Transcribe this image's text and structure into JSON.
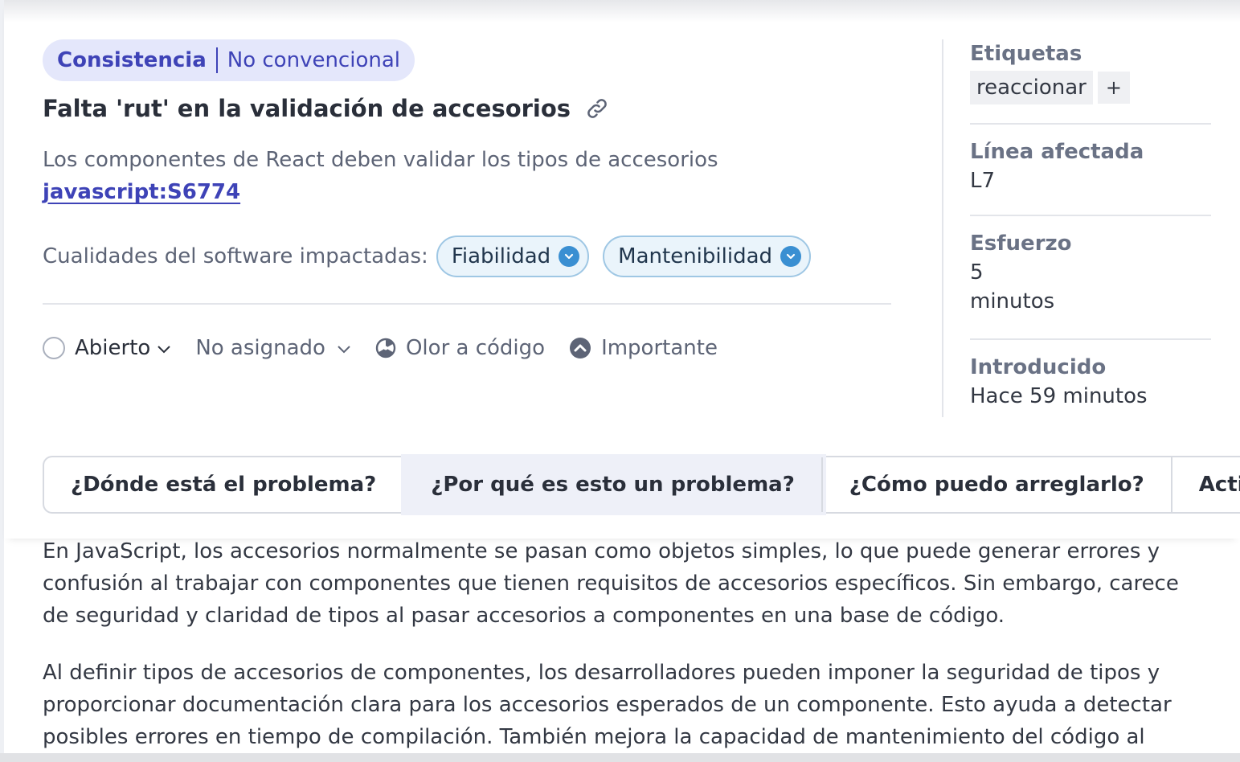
{
  "badge": {
    "category": "Consistencia",
    "attribute": "No convencional"
  },
  "issue": {
    "title": "Falta 'rut' en la validación de accesorios",
    "rule_description": "Los componentes de React deben validar los tipos de accesorios",
    "rule_key": "javascript:S6774"
  },
  "qualities": {
    "label": "Cualidades del software impactadas:",
    "items": [
      {
        "name": "Fiabilidad"
      },
      {
        "name": "Mantenibilidad"
      }
    ]
  },
  "status_row": {
    "status": "Abierto",
    "assignee": "No asignado",
    "type": "Olor a código",
    "severity": "Importante"
  },
  "sidebar": {
    "tags_label": "Etiquetas",
    "tag": "reaccionar",
    "add_tag": "+",
    "line_label": "Línea afectada",
    "line_value": "L7",
    "effort_label": "Esfuerzo",
    "effort_value": "5",
    "effort_unit": "minutos",
    "introduced_label": "Introducido",
    "introduced_value": "Hace 59 minutos"
  },
  "tabs": [
    {
      "label": "¿Dónde está el problema?",
      "selected": false
    },
    {
      "label": "¿Por qué es esto un problema?",
      "selected": true
    },
    {
      "label": "¿Cómo puedo arreglarlo?",
      "selected": false
    },
    {
      "label": "Actividad",
      "selected": false
    }
  ],
  "article": {
    "paragraphs": [
      "En JavaScript, los accesorios normalmente se pasan como objetos simples, lo que puede generar errores y confusión al trabajar con componentes que tienen requisitos de accesorios específicos. Sin embargo, carece de seguridad y claridad de tipos al pasar accesorios a componentes en una base de código.",
      "Al definir tipos de accesorios de componentes, los desarrolladores pueden imponer la seguridad de tipos y proporcionar documentación clara para los accesorios esperados de un componente. Esto ayuda a detectar posibles errores en tiempo de compilación. También mejora la capacidad de mantenimiento del código al"
    ]
  },
  "colors": {
    "accent": "#3e43b7",
    "badge_bg": "#e4e7fb",
    "quality_bg": "#eaf4fb",
    "quality_border": "#9fc7e4",
    "quality_icon": "#3a8fd2"
  },
  "icons": {
    "permalink": "link-icon",
    "quality_chevron": "chevron-down-circle-icon",
    "status": "open-circle-icon",
    "type": "code-smell-icon",
    "severity": "severity-major-icon"
  }
}
